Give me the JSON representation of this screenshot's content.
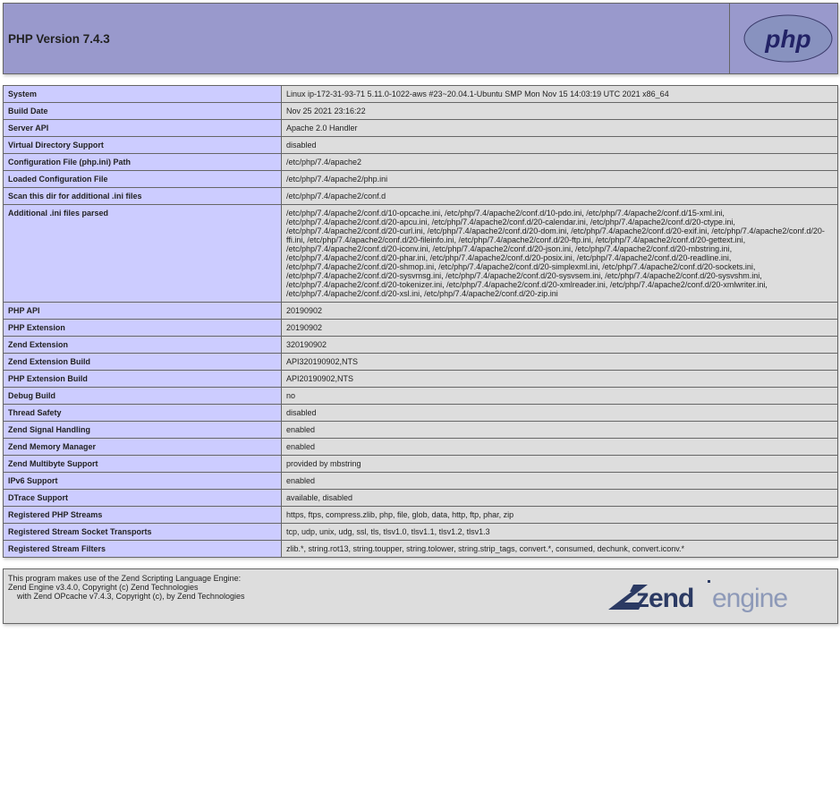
{
  "header": {
    "title": "PHP Version 7.4.3"
  },
  "info": {
    "rows": [
      {
        "k": "System",
        "v": "Linux ip-172-31-93-71 5.11.0-1022-aws #23~20.04.1-Ubuntu SMP Mon Nov 15 14:03:19 UTC 2021 x86_64"
      },
      {
        "k": "Build Date",
        "v": "Nov 25 2021 23:16:22"
      },
      {
        "k": "Server API",
        "v": "Apache 2.0 Handler"
      },
      {
        "k": "Virtual Directory Support",
        "v": "disabled"
      },
      {
        "k": "Configuration File (php.ini) Path",
        "v": "/etc/php/7.4/apache2"
      },
      {
        "k": "Loaded Configuration File",
        "v": "/etc/php/7.4/apache2/php.ini"
      },
      {
        "k": "Scan this dir for additional .ini files",
        "v": "/etc/php/7.4/apache2/conf.d"
      },
      {
        "k": "Additional .ini files parsed",
        "v": "/etc/php/7.4/apache2/conf.d/10-opcache.ini, /etc/php/7.4/apache2/conf.d/10-pdo.ini, /etc/php/7.4/apache2/conf.d/15-xml.ini, /etc/php/7.4/apache2/conf.d/20-apcu.ini, /etc/php/7.4/apache2/conf.d/20-calendar.ini, /etc/php/7.4/apache2/conf.d/20-ctype.ini, /etc/php/7.4/apache2/conf.d/20-curl.ini, /etc/php/7.4/apache2/conf.d/20-dom.ini, /etc/php/7.4/apache2/conf.d/20-exif.ini, /etc/php/7.4/apache2/conf.d/20-ffi.ini, /etc/php/7.4/apache2/conf.d/20-fileinfo.ini, /etc/php/7.4/apache2/conf.d/20-ftp.ini, /etc/php/7.4/apache2/conf.d/20-gettext.ini, /etc/php/7.4/apache2/conf.d/20-iconv.ini, /etc/php/7.4/apache2/conf.d/20-json.ini, /etc/php/7.4/apache2/conf.d/20-mbstring.ini, /etc/php/7.4/apache2/conf.d/20-phar.ini, /etc/php/7.4/apache2/conf.d/20-posix.ini, /etc/php/7.4/apache2/conf.d/20-readline.ini, /etc/php/7.4/apache2/conf.d/20-shmop.ini, /etc/php/7.4/apache2/conf.d/20-simplexml.ini, /etc/php/7.4/apache2/conf.d/20-sockets.ini, /etc/php/7.4/apache2/conf.d/20-sysvmsg.ini, /etc/php/7.4/apache2/conf.d/20-sysvsem.ini, /etc/php/7.4/apache2/conf.d/20-sysvshm.ini, /etc/php/7.4/apache2/conf.d/20-tokenizer.ini, /etc/php/7.4/apache2/conf.d/20-xmlreader.ini, /etc/php/7.4/apache2/conf.d/20-xmlwriter.ini, /etc/php/7.4/apache2/conf.d/20-xsl.ini, /etc/php/7.4/apache2/conf.d/20-zip.ini"
      },
      {
        "k": "PHP API",
        "v": "20190902"
      },
      {
        "k": "PHP Extension",
        "v": "20190902"
      },
      {
        "k": "Zend Extension",
        "v": "320190902"
      },
      {
        "k": "Zend Extension Build",
        "v": "API320190902,NTS"
      },
      {
        "k": "PHP Extension Build",
        "v": "API20190902,NTS"
      },
      {
        "k": "Debug Build",
        "v": "no"
      },
      {
        "k": "Thread Safety",
        "v": "disabled"
      },
      {
        "k": "Zend Signal Handling",
        "v": "enabled"
      },
      {
        "k": "Zend Memory Manager",
        "v": "enabled"
      },
      {
        "k": "Zend Multibyte Support",
        "v": "provided by mbstring"
      },
      {
        "k": "IPv6 Support",
        "v": "enabled"
      },
      {
        "k": "DTrace Support",
        "v": "available, disabled"
      },
      {
        "k": "Registered PHP Streams",
        "v": "https, ftps, compress.zlib, php, file, glob, data, http, ftp, phar, zip"
      },
      {
        "k": "Registered Stream Socket Transports",
        "v": "tcp, udp, unix, udg, ssl, tls, tlsv1.0, tlsv1.1, tlsv1.2, tlsv1.3"
      },
      {
        "k": "Registered Stream Filters",
        "v": "zlib.*, string.rot13, string.toupper, string.tolower, string.strip_tags, convert.*, consumed, dechunk, convert.iconv.*"
      }
    ]
  },
  "zend": {
    "line1": "This program makes use of the Zend Scripting Language Engine:",
    "line2": "Zend Engine v3.4.0, Copyright (c) Zend Technologies",
    "line3": "    with Zend OPcache v7.4.3, Copyright (c), by Zend Technologies"
  },
  "colors": {
    "header_bg": "#9999cc",
    "key_bg": "#ccccff",
    "val_bg": "#dddddd"
  }
}
